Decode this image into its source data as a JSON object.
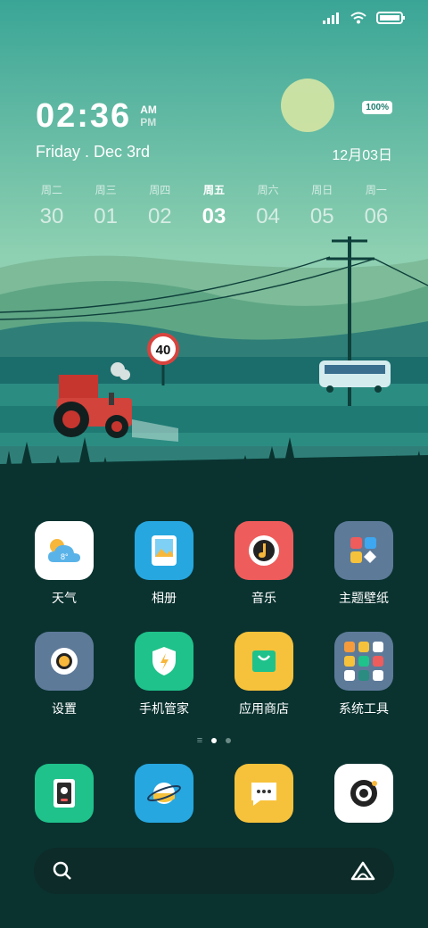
{
  "status_bar": {
    "signal_icon": "signal-icon",
    "wifi_icon": "wifi-icon",
    "battery_icon": "battery-icon"
  },
  "clock": {
    "time": "02:36",
    "am": "AM",
    "pm": "PM",
    "battery_percent": "100%",
    "date_en": "Friday . Dec 3rd",
    "date_cn": "12月03日"
  },
  "week": [
    {
      "w": "周二",
      "n": "30"
    },
    {
      "w": "周三",
      "n": "01"
    },
    {
      "w": "周四",
      "n": "02"
    },
    {
      "w": "周五",
      "n": "03",
      "active": true
    },
    {
      "w": "周六",
      "n": "04"
    },
    {
      "w": "周日",
      "n": "05"
    },
    {
      "w": "周一",
      "n": "06"
    }
  ],
  "wallpaper": {
    "speed_sign": "40"
  },
  "apps": [
    {
      "label": "天气",
      "icon": "weather-icon",
      "temp": "8°"
    },
    {
      "label": "相册",
      "icon": "gallery-icon"
    },
    {
      "label": "音乐",
      "icon": "music-icon"
    },
    {
      "label": "主题壁纸",
      "icon": "themes-icon"
    },
    {
      "label": "设置",
      "icon": "settings-icon"
    },
    {
      "label": "手机管家",
      "icon": "security-icon"
    },
    {
      "label": "应用商店",
      "icon": "app-store-icon"
    },
    {
      "label": "系统工具",
      "icon": "folder-icon"
    }
  ],
  "dock": [
    {
      "icon": "phone-icon"
    },
    {
      "icon": "browser-icon"
    },
    {
      "icon": "messages-icon"
    },
    {
      "icon": "camera-icon"
    }
  ],
  "search_bar": {
    "search_icon": "search-icon",
    "assistant_icon": "assistant-icon"
  }
}
